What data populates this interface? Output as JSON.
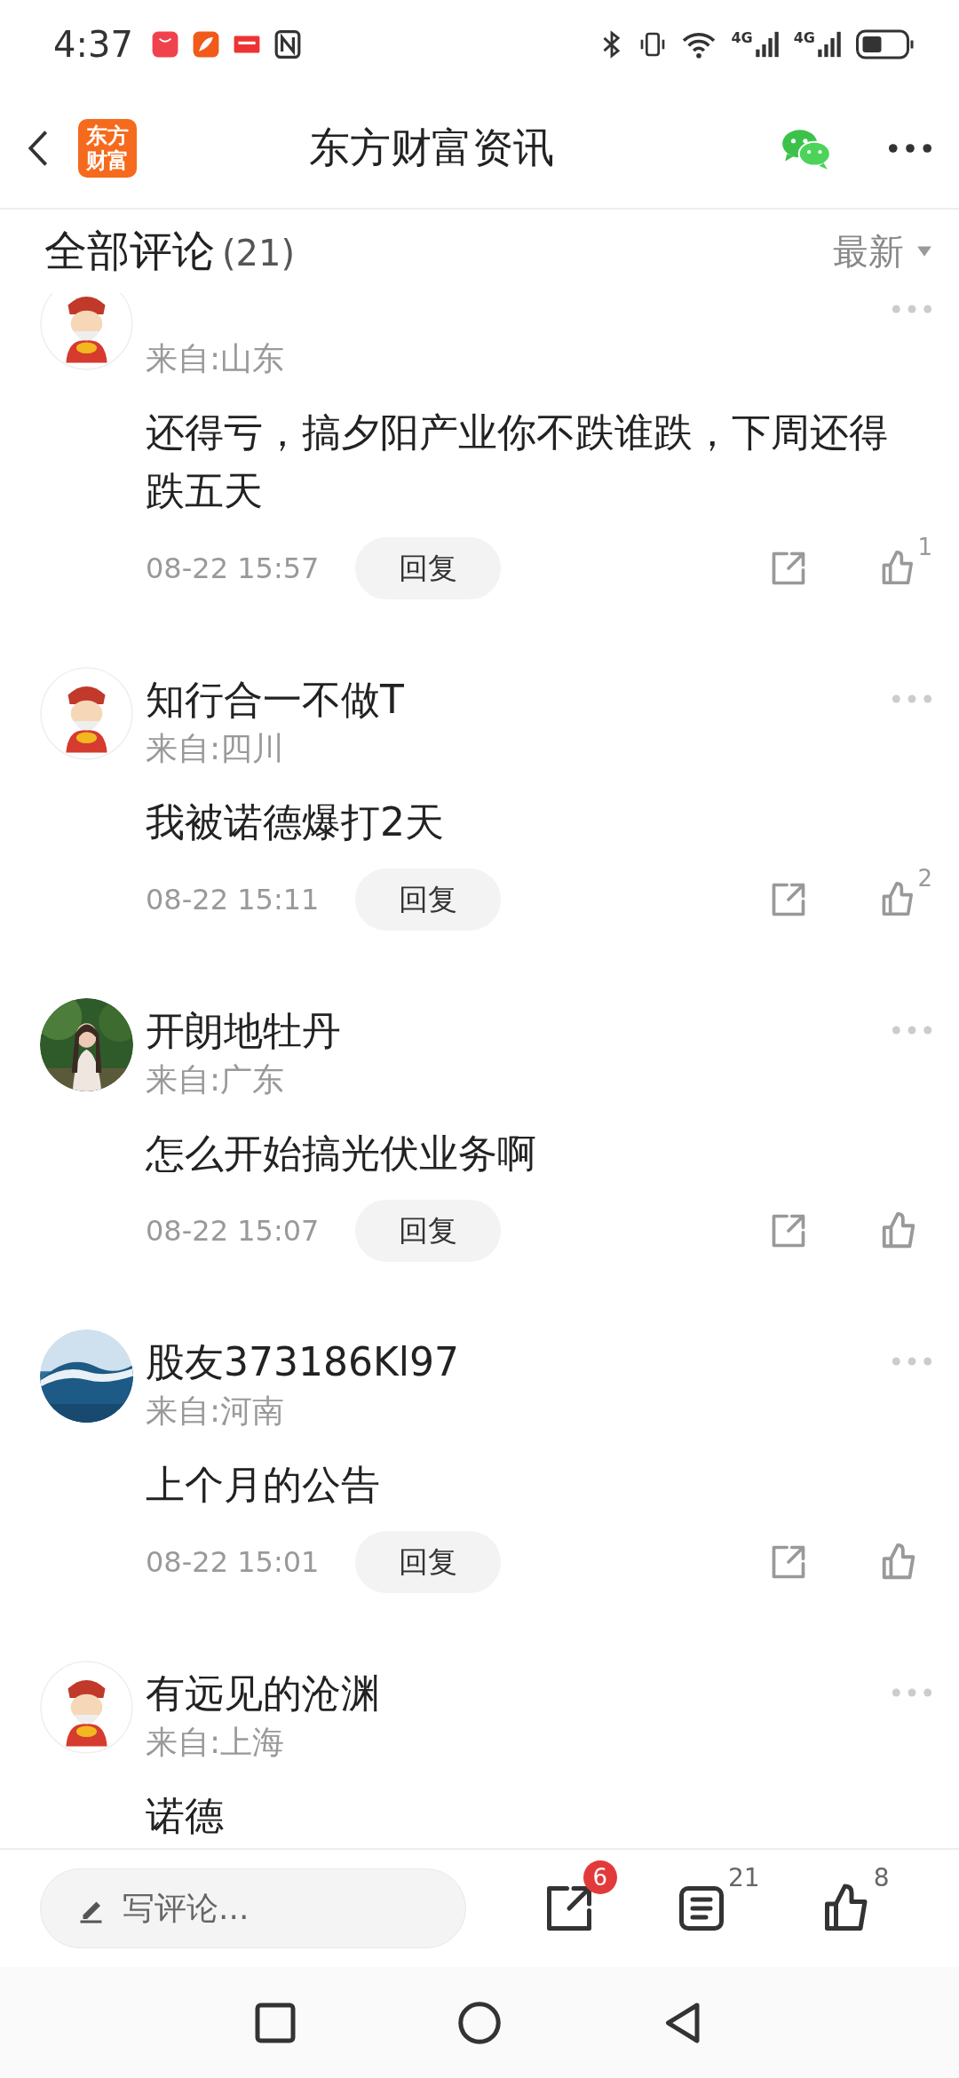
{
  "status_bar": {
    "time": "4:37",
    "network": [
      "4G",
      "4G"
    ]
  },
  "header": {
    "logo_lines": [
      "东方",
      "财富"
    ],
    "title": "东方财富资讯"
  },
  "comments_header": {
    "title": "全部评论",
    "count": "(21)",
    "sort": "最新"
  },
  "comments": [
    {
      "avatar": {
        "kind": "mascot"
      },
      "location": "来自:山东",
      "body": "还得亏，搞夕阳产业你不跌谁跌，下周还得跌五天",
      "date": "08-22 15:57",
      "reply": "回复",
      "likes": "1"
    },
    {
      "avatar": {
        "kind": "mascot"
      },
      "name": "知行合一不做T",
      "location": "来自:四川",
      "body": "我被诺德爆打2天",
      "date": "08-22 15:11",
      "reply": "回复",
      "likes": "2"
    },
    {
      "name": "开朗地牡丹",
      "location": "来自:广东",
      "body": "怎么开始搞光伏业务啊",
      "date": "08-22 15:07",
      "reply": "回复"
    },
    {
      "avatar": {
        "kind": "wave-picture"
      },
      "name": "股友373186Kl97",
      "location": "来自:河南",
      "body": "上个月的公告",
      "date": "08-22 15:01",
      "reply": "回复"
    },
    {
      "avatar": {
        "kind": "mascot"
      },
      "name": "有远见的沧渊",
      "location": "来自:上海",
      "body": "诺德"
    }
  ],
  "bottom_bar": {
    "placeholder": "写评论...",
    "share_badge": "6",
    "comment_count": "21",
    "like_count": "8"
  }
}
